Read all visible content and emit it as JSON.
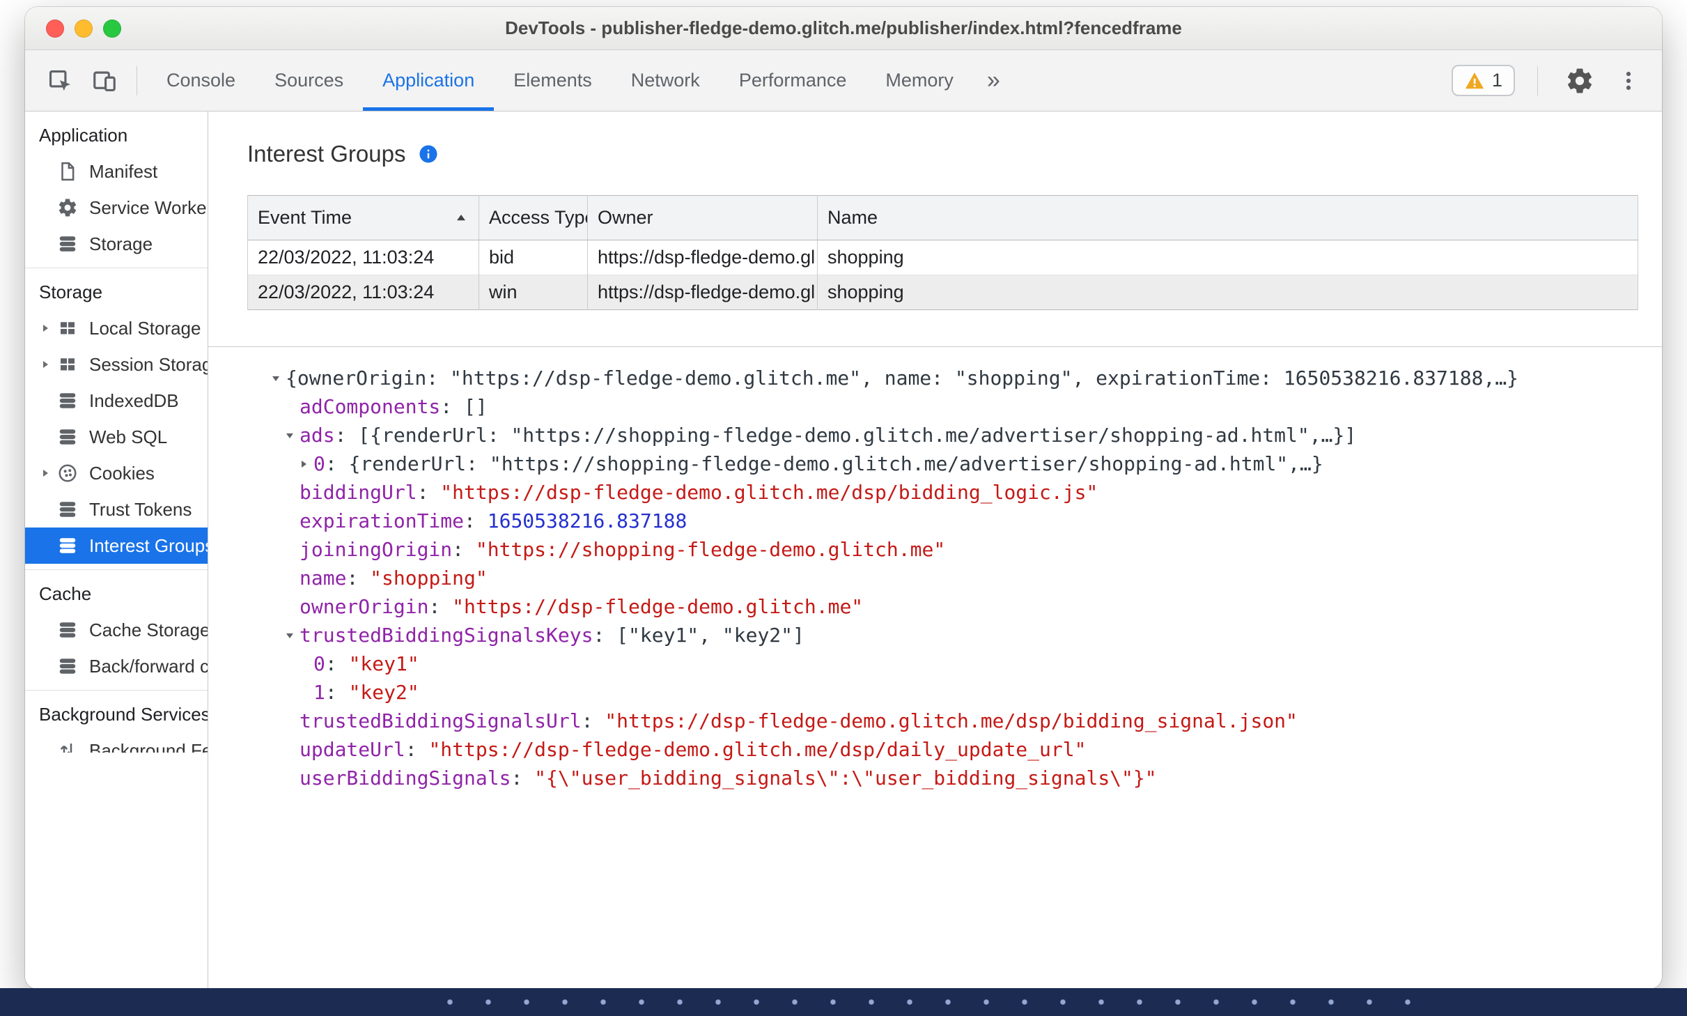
{
  "window": {
    "title": "DevTools - publisher-fledge-demo.glitch.me/publisher/index.html?fencedframe"
  },
  "colors": {
    "accent": "#1a73e8",
    "selected_bg": "#1a73e8",
    "warning": "#f0a821",
    "json_key": "#8f24a8",
    "json_string": "#c41a16",
    "json_number": "#2430cf"
  },
  "toolbar": {
    "tabs": [
      {
        "label": "Console",
        "active": false
      },
      {
        "label": "Sources",
        "active": false
      },
      {
        "label": "Application",
        "active": true
      },
      {
        "label": "Elements",
        "active": false
      },
      {
        "label": "Network",
        "active": false
      },
      {
        "label": "Performance",
        "active": false
      },
      {
        "label": "Memory",
        "active": false
      }
    ],
    "more_tabs_label": "»",
    "warning_count": "1"
  },
  "sidebar": {
    "sections": [
      {
        "title": "Application",
        "items": [
          {
            "label": "Manifest",
            "icon": "file-icon"
          },
          {
            "label": "Service Workers",
            "icon": "gear-icon"
          },
          {
            "label": "Storage",
            "icon": "database-icon"
          }
        ]
      },
      {
        "title": "Storage",
        "items": [
          {
            "label": "Local Storage",
            "icon": "table-icon",
            "expandable": true
          },
          {
            "label": "Session Storage",
            "icon": "table-icon",
            "expandable": true
          },
          {
            "label": "IndexedDB",
            "icon": "database-icon"
          },
          {
            "label": "Web SQL",
            "icon": "database-icon"
          },
          {
            "label": "Cookies",
            "icon": "cookie-icon",
            "expandable": true
          },
          {
            "label": "Trust Tokens",
            "icon": "database-icon"
          },
          {
            "label": "Interest Groups",
            "icon": "database-icon",
            "selected": true
          }
        ]
      },
      {
        "title": "Cache",
        "items": [
          {
            "label": "Cache Storage",
            "icon": "database-icon"
          },
          {
            "label": "Back/forward cache",
            "icon": "database-icon"
          }
        ]
      },
      {
        "title": "Background Services",
        "items": [
          {
            "label": "Background Fetch",
            "icon": "fetch-icon"
          }
        ]
      }
    ]
  },
  "main": {
    "title": "Interest Groups",
    "table": {
      "columns": [
        "Event Time",
        "Access Type",
        "Owner",
        "Name"
      ],
      "sorted_column": "Event Time",
      "sort_direction": "ascending",
      "rows": [
        {
          "event_time": "22/03/2022, 11:03:24",
          "access_type": "bid",
          "owner": "https://dsp-fledge-demo.gl…",
          "name": "shopping"
        },
        {
          "event_time": "22/03/2022, 11:03:24",
          "access_type": "win",
          "owner": "https://dsp-fledge-demo.gl…",
          "name": "shopping"
        }
      ]
    },
    "details": {
      "lines": [
        {
          "level": 0,
          "arrow": "down",
          "segments": [
            {
              "text": "{ownerOrigin: \"https://dsp-fledge-demo.glitch.me\", name: \"shopping\", expirationTime: 1650538216.837188,…}",
              "type": "plain"
            }
          ]
        },
        {
          "level": 1,
          "arrow": "none",
          "segments": [
            {
              "text": "adComponents",
              "type": "key"
            },
            {
              "text": ": []",
              "type": "plain"
            }
          ]
        },
        {
          "level": 1,
          "arrow": "down",
          "segments": [
            {
              "text": "ads",
              "type": "key"
            },
            {
              "text": ": [{renderUrl: \"https://shopping-fledge-demo.glitch.me/advertiser/shopping-ad.html\",…}]",
              "type": "plain"
            }
          ]
        },
        {
          "level": 2,
          "arrow": "right",
          "segments": [
            {
              "text": "0",
              "type": "key"
            },
            {
              "text": ": {renderUrl: \"https://shopping-fledge-demo.glitch.me/advertiser/shopping-ad.html\",…}",
              "type": "plain"
            }
          ]
        },
        {
          "level": 1,
          "arrow": "none",
          "segments": [
            {
              "text": "biddingUrl",
              "type": "key"
            },
            {
              "text": ": ",
              "type": "plain"
            },
            {
              "text": "\"https://dsp-fledge-demo.glitch.me/dsp/bidding_logic.js\"",
              "type": "string"
            }
          ]
        },
        {
          "level": 1,
          "arrow": "none",
          "segments": [
            {
              "text": "expirationTime",
              "type": "key"
            },
            {
              "text": ": ",
              "type": "plain"
            },
            {
              "text": "1650538216.837188",
              "type": "number"
            }
          ]
        },
        {
          "level": 1,
          "arrow": "none",
          "segments": [
            {
              "text": "joiningOrigin",
              "type": "key"
            },
            {
              "text": ": ",
              "type": "plain"
            },
            {
              "text": "\"https://shopping-fledge-demo.glitch.me\"",
              "type": "string"
            }
          ]
        },
        {
          "level": 1,
          "arrow": "none",
          "segments": [
            {
              "text": "name",
              "type": "key"
            },
            {
              "text": ": ",
              "type": "plain"
            },
            {
              "text": "\"shopping\"",
              "type": "string"
            }
          ]
        },
        {
          "level": 1,
          "arrow": "none",
          "segments": [
            {
              "text": "ownerOrigin",
              "type": "key"
            },
            {
              "text": ": ",
              "type": "plain"
            },
            {
              "text": "\"https://dsp-fledge-demo.glitch.me\"",
              "type": "string"
            }
          ]
        },
        {
          "level": 1,
          "arrow": "down",
          "segments": [
            {
              "text": "trustedBiddingSignalsKeys",
              "type": "key"
            },
            {
              "text": ": [\"key1\", \"key2\"]",
              "type": "plain"
            }
          ]
        },
        {
          "level": 2,
          "arrow": "none",
          "segments": [
            {
              "text": "0",
              "type": "key"
            },
            {
              "text": ": ",
              "type": "plain"
            },
            {
              "text": "\"key1\"",
              "type": "string"
            }
          ]
        },
        {
          "level": 2,
          "arrow": "none",
          "segments": [
            {
              "text": "1",
              "type": "key"
            },
            {
              "text": ": ",
              "type": "plain"
            },
            {
              "text": "\"key2\"",
              "type": "string"
            }
          ]
        },
        {
          "level": 1,
          "arrow": "none",
          "segments": [
            {
              "text": "trustedBiddingSignalsUrl",
              "type": "key"
            },
            {
              "text": ": ",
              "type": "plain"
            },
            {
              "text": "\"https://dsp-fledge-demo.glitch.me/dsp/bidding_signal.json\"",
              "type": "string"
            }
          ]
        },
        {
          "level": 1,
          "arrow": "none",
          "segments": [
            {
              "text": "updateUrl",
              "type": "key"
            },
            {
              "text": ": ",
              "type": "plain"
            },
            {
              "text": "\"https://dsp-fledge-demo.glitch.me/dsp/daily_update_url\"",
              "type": "string"
            }
          ]
        },
        {
          "level": 1,
          "arrow": "none",
          "segments": [
            {
              "text": "userBiddingSignals",
              "type": "key"
            },
            {
              "text": ": ",
              "type": "plain"
            },
            {
              "text": "\"{\\\"user_bidding_signals\\\":\\\"user_bidding_signals\\\"}\"",
              "type": "string"
            }
          ]
        }
      ]
    }
  }
}
